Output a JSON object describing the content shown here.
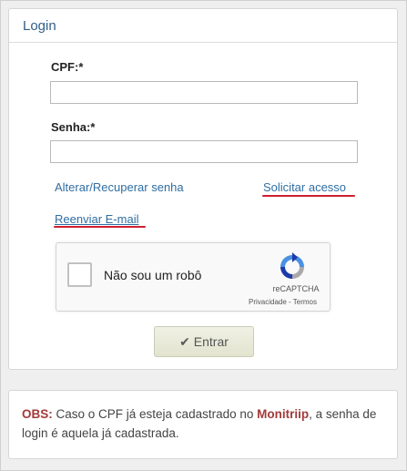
{
  "panel": {
    "title": "Login"
  },
  "form": {
    "cpf_label": "CPF:*",
    "cpf_value": "",
    "senha_label": "Senha:*",
    "senha_value": ""
  },
  "links": {
    "recover": "Alterar/Recuperar senha",
    "request": "Solicitar acesso",
    "resend": "Reenviar E-mail"
  },
  "captcha": {
    "label": "Não sou um robô",
    "brand": "reCAPTCHA",
    "privacy": "Privacidade",
    "separator": " - ",
    "terms": "Termos"
  },
  "submit": {
    "label": "Entrar",
    "icon": "check-icon"
  },
  "notice": {
    "prefix": "OBS:",
    "text_before": " Caso o CPF já esteja cadastrado no ",
    "system": "Monitriip",
    "text_after": ", a senha de login é aquela já cadastrada."
  },
  "colors": {
    "header_text": "#2e5f8a",
    "link": "#2f6ea3",
    "annotation_red": "#d0202e",
    "obs_red": "#a33a3a"
  }
}
